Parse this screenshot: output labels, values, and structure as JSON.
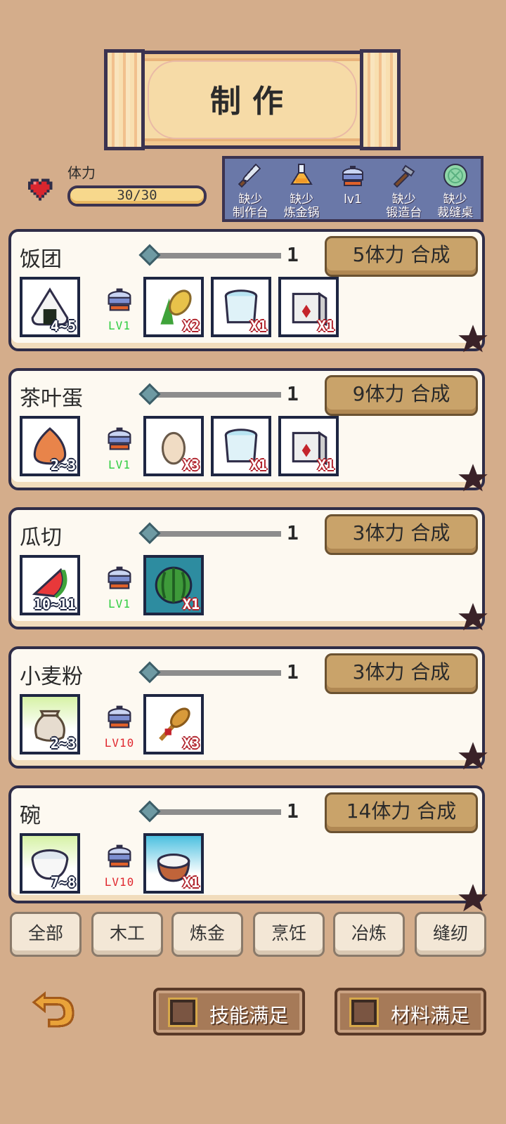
{
  "title": "制作",
  "stamina": {
    "label": "体力",
    "value": "30/30",
    "fraction": 1.0
  },
  "tools": [
    {
      "icon": "knife-icon",
      "line1": "缺少",
      "line2": "制作台"
    },
    {
      "icon": "flask-icon",
      "line1": "缺少",
      "line2": "炼金锅"
    },
    {
      "icon": "pot-icon",
      "line1": "",
      "line2": "lv1"
    },
    {
      "icon": "hammer-icon",
      "line1": "缺少",
      "line2": "锻造台"
    },
    {
      "icon": "yarn-icon",
      "line1": "缺少",
      "line2": "裁缝桌"
    }
  ],
  "recipes": [
    {
      "name": "饭团",
      "qty": "1",
      "craft": "5体力 合成",
      "output_icon": "onigiri-icon",
      "output_count": "4~5",
      "level": "LV1",
      "level_color": "#2ecc40",
      "ingredients": [
        {
          "icon": "corn-icon",
          "count": "X2"
        },
        {
          "icon": "water-bucket-icon",
          "count": "X1"
        },
        {
          "icon": "salt-icon",
          "count": "X1"
        }
      ]
    },
    {
      "name": "茶叶蛋",
      "qty": "1",
      "craft": "9体力 合成",
      "output_icon": "tea-egg-icon",
      "output_count": "2~3",
      "level": "LV1",
      "level_color": "#2ecc40",
      "ingredients": [
        {
          "icon": "egg-icon",
          "count": "X3"
        },
        {
          "icon": "water-bucket-icon",
          "count": "X1"
        },
        {
          "icon": "salt-icon",
          "count": "X1"
        }
      ]
    },
    {
      "name": "瓜切",
      "qty": "1",
      "craft": "3体力 合成",
      "output_icon": "watermelon-slice-icon",
      "output_count": "10~11",
      "level": "LV1",
      "level_color": "#2ecc40",
      "ingredients": [
        {
          "icon": "watermelon-icon",
          "count": "X1"
        }
      ]
    },
    {
      "name": "小麦粉",
      "qty": "1",
      "craft": "3体力 合成",
      "output_icon": "flour-sack-icon",
      "output_count": "2~3",
      "level": "LV10",
      "level_color": "#e0282f",
      "ingredients": [
        {
          "icon": "wheat-icon",
          "count": "X3"
        }
      ]
    },
    {
      "name": "碗",
      "qty": "1",
      "craft": "14体力 合成",
      "output_icon": "bowl-icon",
      "output_count": "7~8",
      "level": "LV10",
      "level_color": "#e0282f",
      "ingredients": [
        {
          "icon": "coconut-icon",
          "count": "X1"
        }
      ]
    }
  ],
  "tabs": [
    "全部",
    "木工",
    "炼金",
    "烹饪",
    "冶炼",
    "缝纫"
  ],
  "filters": {
    "skill": "技能满足",
    "material": "材料满足"
  }
}
